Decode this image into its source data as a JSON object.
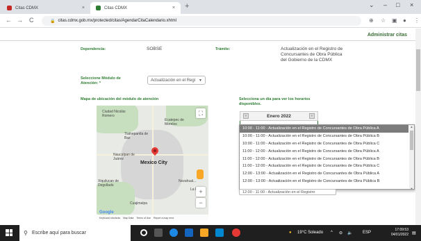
{
  "browser": {
    "tabs": [
      {
        "label": "Citas CDMX",
        "color": "#c62828"
      },
      {
        "label": "Citas CDMX",
        "color": "#2e7d32"
      }
    ],
    "url": "citas.cdmx.gob.mx/protected/citas/AgendarCitaCalendario.xhtml",
    "new_tab": "+",
    "close": "×",
    "minimize": "–",
    "maximize": "□",
    "back": "←",
    "forward": "→",
    "reload": "C"
  },
  "header": {
    "admin_label": "Administrar citas"
  },
  "form": {
    "dependencia_label": "Dependencia:",
    "dependencia_value": "SOBSE",
    "tramite_label": "Trámite:",
    "tramite_value": "Actualización en el Registro de Concursantes de Obra Pública del Gobierno de la CDMX",
    "modulo_label": "Seleccione Módulo de Atención: *",
    "modulo_value": "Actualización en el Regi",
    "mapa_label": "Mapa de ubicación del módulo de atención",
    "dia_label": "Selecciona un día para ver los horarios disponibles."
  },
  "map": {
    "labels": [
      "Ciudad Nicolás Romero",
      "Ecatepec de Morelos",
      "Tlalnepantla de Baz",
      "Naucalpan de Juárez",
      "Xiquilucan de Degollado",
      "La Paz",
      "Nezahual...",
      "Cuajimalpa"
    ],
    "city": "Mexico City",
    "zoom_in": "+",
    "zoom_out": "−",
    "fullscreen": "⛶",
    "google": "Google",
    "footer": [
      "Keyboard shortcuts",
      "Map Data",
      "Terms of Use",
      "Report a map error"
    ]
  },
  "calendar": {
    "month": "Enero 2022",
    "prev": "‹",
    "next": "›"
  },
  "horarios": {
    "options": [
      "10:00 - 11:00 - Actualización en el Registro de Concursantes de Obra Pública A",
      "10:00 - 11:00 - Actualización en el Registro de Concursantes de Obra Pública B",
      "10:00 - 11:00 - Actualización en el Registro de Concursantes de Obra Pública C",
      "11:00 - 12:00 - Actualización en el Registro de Concursantes de Obra Pública A",
      "11:00 - 12:00 - Actualización en el Registro de Concursantes de Obra Pública B",
      "11:00 - 12:00 - Actualización en el Registro de Concursantes de Obra Pública C",
      "12:00 - 13:00 - Actualización en el Registro de Concursantes de Obra Pública A",
      "12:00 - 13:00 - Actualización en el Registro de Concursantes de Obra Pública B"
    ],
    "selected_index": 0,
    "current": "12:00 - 11:00 - Actualización en el Registro"
  },
  "taskbar": {
    "search_placeholder": "Escribe aquí para buscar",
    "weather": "19°C Soleado",
    "lang": "ESP",
    "time": "17:09:53",
    "date": "04/01/2022"
  },
  "colors": {
    "accent": "#2e7d32",
    "selected": "#7c7c7c"
  }
}
